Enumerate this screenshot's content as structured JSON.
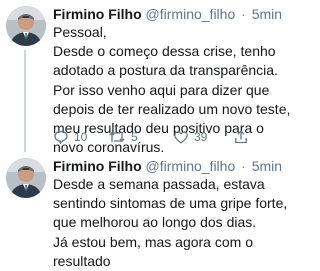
{
  "tweets": [
    {
      "author": {
        "name": "Firmino Filho",
        "handle": "@firmino_filho"
      },
      "separator": "·",
      "time": "5min",
      "paragraphs": [
        "Pessoal,",
        "Desde o começo dessa crise, tenho adotado a postura da transparência. Por isso venho aqui para dizer que depois de ter realizado um novo teste, meu resultado deu positivo para o novo coronavírus."
      ],
      "stats": {
        "replies": "10",
        "retweets": "5",
        "likes": "39"
      },
      "icons": [
        "reply-icon",
        "retweet-icon",
        "like-icon",
        "share-icon"
      ]
    },
    {
      "author": {
        "name": "Firmino Filho",
        "handle": "@firmino_filho"
      },
      "separator": "·",
      "time": "5min",
      "paragraphs": [
        "Desde a semana passada, estava sentindo sintomas de uma gripe forte, que melhorou ao longo dos dias.",
        "Já estou bem, mas agora com o resultado"
      ]
    }
  ],
  "colors": {
    "text": "#14171a",
    "muted": "#657786",
    "thread_line": "#ccd6dd"
  }
}
